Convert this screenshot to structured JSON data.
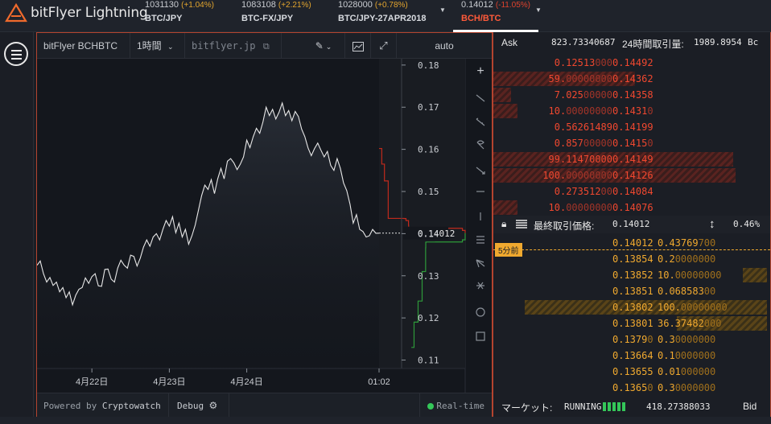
{
  "app": {
    "logo_text": "bitFlyer Lightning"
  },
  "markets": [
    {
      "price": "1031130",
      "change": "(+1.04%)",
      "name": "BTC/JPY",
      "change_color": "#e3a52e"
    },
    {
      "price": "1083108",
      "change": "(+2.21%)",
      "name": "BTC-FX/JPY",
      "change_color": "#e3a52e"
    },
    {
      "price": "1028000",
      "change": "(+0.78%)",
      "name": "BTC/JPY-27APR2018",
      "change_color": "#e3a52e"
    },
    {
      "price": "0.14012",
      "change": "(-11.05%)",
      "name": "BCH/BTC",
      "change_color": "#e0432d",
      "active": true
    }
  ],
  "chart_toolbar": {
    "symbol": "bitFlyer BCHBTC",
    "interval": "1時間",
    "exchange": "bitflyer.jp",
    "scale": "auto"
  },
  "chart_footer": {
    "powered_by": "Powered by ",
    "powered_by_brand": "Cryptowatch",
    "debug": "Debug",
    "realtime": "Real-time"
  },
  "chart_data": {
    "type": "line",
    "title": "",
    "xlabel": "",
    "ylabel": "",
    "ylim": [
      0.108,
      0.1815
    ],
    "y_ticks": [
      "0.18",
      "0.17",
      "0.16",
      "0.15",
      "0.14",
      "0.13",
      "0.12",
      "0.11"
    ],
    "y_tick_values": [
      0.18,
      0.17,
      0.16,
      0.15,
      0.14,
      0.13,
      0.12,
      0.11
    ],
    "x_ticks": [
      "4月22日",
      "4月23日",
      "4月24日",
      "01:02"
    ],
    "x_tick_hours": [
      17,
      41,
      65,
      106
    ],
    "last_price_label": "0.14012",
    "last_price": 0.14012,
    "series": [
      {
        "values": [
          0.1325,
          0.1335,
          0.1305,
          0.1285,
          0.1296,
          0.1277,
          0.1285,
          0.1262,
          0.1272,
          0.1248,
          0.1262,
          0.1231,
          0.1254,
          0.1268,
          0.1272,
          0.1295,
          0.1282,
          0.1298,
          0.1305,
          0.1276,
          0.1275,
          0.1315,
          0.1316,
          0.1292,
          0.1285,
          0.1318,
          0.1337,
          0.1325,
          0.1318,
          0.1349,
          0.1346,
          0.1323,
          0.1342,
          0.1368,
          0.1385,
          0.137,
          0.1392,
          0.14,
          0.1385,
          0.141,
          0.1431,
          0.1418,
          0.144,
          0.1402,
          0.1425,
          0.1392,
          0.141,
          0.1375,
          0.1395,
          0.142,
          0.1455,
          0.149,
          0.1515,
          0.1505,
          0.1528,
          0.1495,
          0.153,
          0.1555,
          0.153,
          0.1572,
          0.1578,
          0.1568,
          0.1552,
          0.1565,
          0.1582,
          0.1622,
          0.1604,
          0.163,
          0.165,
          0.1638,
          0.1665,
          0.17,
          0.168,
          0.1695,
          0.1672,
          0.1688,
          0.171,
          0.168,
          0.1692,
          0.1668,
          0.169,
          0.1678,
          0.1648,
          0.163,
          0.1603,
          0.1585,
          0.1602,
          0.1615,
          0.1598,
          0.1582,
          0.1595,
          0.1562,
          0.155,
          0.1578,
          0.1555,
          0.152,
          0.1502,
          0.147,
          0.1425,
          0.1445,
          0.141,
          0.1405,
          0.1392,
          0.1395,
          0.141,
          0.1401,
          0.14012
        ]
      }
    ],
    "depth_asks": [
      [
        0.14012,
        0
      ],
      [
        0.14076,
        10
      ],
      [
        0.14084,
        10.3
      ],
      [
        0.14126,
        110
      ],
      [
        0.14149,
        209
      ],
      [
        0.1415,
        210
      ],
      [
        0.14199,
        210.6
      ],
      [
        0.1431,
        220
      ],
      [
        0.14358,
        227
      ],
      [
        0.14362,
        286
      ],
      [
        0.14492,
        286
      ],
      [
        0.1525,
        300
      ],
      [
        0.1565,
        310
      ],
      [
        0.1602,
        320
      ]
    ],
    "depth_bids": [
      [
        0.14012,
        0
      ],
      [
        0.13854,
        0.2
      ],
      [
        0.13852,
        10.2
      ],
      [
        0.13851,
        10.3
      ],
      [
        0.13802,
        110
      ],
      [
        0.13801,
        146
      ],
      [
        0.1379,
        146.5
      ],
      [
        0.13664,
        147
      ],
      [
        0.13655,
        147
      ],
      [
        0.1365,
        147
      ],
      [
        0.131,
        160
      ],
      [
        0.124,
        175
      ],
      [
        0.119,
        190
      ],
      [
        0.113,
        200
      ]
    ]
  },
  "orderbook": {
    "ask_label": "Ask",
    "ask_total": "823.73340687",
    "volume_label": "24時間取引量:",
    "volume": "1989.8954",
    "volume_unit": "Bc",
    "asks": [
      {
        "size_main": "0.12513",
        "size_tail": "000",
        "price_main": "0.14492",
        "price_tail": "",
        "depth": 0
      },
      {
        "size_main": "59.",
        "size_tail": "00000000",
        "price_main": "0.14362",
        "price_tail": "",
        "depth": 0.55
      },
      {
        "size_main": "7.025",
        "size_tail": "00000",
        "price_main": "0.14358",
        "price_tail": "",
        "depth": 0.07
      },
      {
        "size_main": "10.",
        "size_tail": "00000000",
        "price_main": "0.1431",
        "price_tail": "0",
        "depth": 0.095
      },
      {
        "size_main": "0.56261489",
        "size_tail": "",
        "price_main": "0.14199",
        "price_tail": "",
        "depth": 0
      },
      {
        "size_main": "0.857",
        "size_tail": "00000",
        "price_main": "0.1415",
        "price_tail": "0",
        "depth": 0
      },
      {
        "size_main": "99.11470000",
        "size_tail": "",
        "price_main": "0.14149",
        "price_tail": "",
        "depth": 0.93
      },
      {
        "size_main": "100.",
        "size_tail": "00000000",
        "price_main": "0.14126",
        "price_tail": "",
        "depth": 0.94
      },
      {
        "size_main": "0.273512",
        "size_tail": "00",
        "price_main": "0.14084",
        "price_tail": "",
        "depth": 0
      },
      {
        "size_main": "10.",
        "size_tail": "00000000",
        "price_main": "0.14076",
        "price_tail": "",
        "depth": 0.095
      }
    ],
    "last_label": "最終取引価格:",
    "last_price": "0.14012",
    "last_change": "0.46%",
    "five_min_badge": "5分前",
    "bids": [
      {
        "price_main": "0.14012",
        "price_tail": "",
        "size_main": "0.43769",
        "size_tail": "700",
        "depth": 0
      },
      {
        "price_main": "0.13854",
        "price_tail": "",
        "size_main": "0.2",
        "size_tail": "0000000",
        "depth": 0
      },
      {
        "price_main": "0.13852",
        "price_tail": "",
        "size_main": "10.",
        "size_tail": "00000000",
        "depth": 0.095
      },
      {
        "price_main": "0.13851",
        "price_tail": "",
        "size_main": "0.068583",
        "size_tail": "00",
        "depth": 0
      },
      {
        "price_main": "0.13802",
        "price_tail": "",
        "size_main": "100.",
        "size_tail": "00000000",
        "depth": 0.94
      },
      {
        "price_main": "0.13801",
        "price_tail": "",
        "size_main": "36.37482",
        "size_tail": "000",
        "depth": 0.35
      },
      {
        "price_main": "0.1379",
        "price_tail": "0",
        "size_main": "0.3",
        "size_tail": "0000000",
        "depth": 0
      },
      {
        "price_main": "0.13664",
        "price_tail": "",
        "size_main": "0.1",
        "size_tail": "0000000",
        "depth": 0
      },
      {
        "price_main": "0.13655",
        "price_tail": "",
        "size_main": "0.01",
        "size_tail": "000000",
        "depth": 0
      },
      {
        "price_main": "0.1365",
        "price_tail": "0",
        "size_main": "0.3",
        "size_tail": "0000000",
        "depth": 0
      }
    ],
    "market_label": "マーケット:",
    "market_status": "RUNNING",
    "bid_total": "418.27388033",
    "bid_label": "Bid"
  }
}
